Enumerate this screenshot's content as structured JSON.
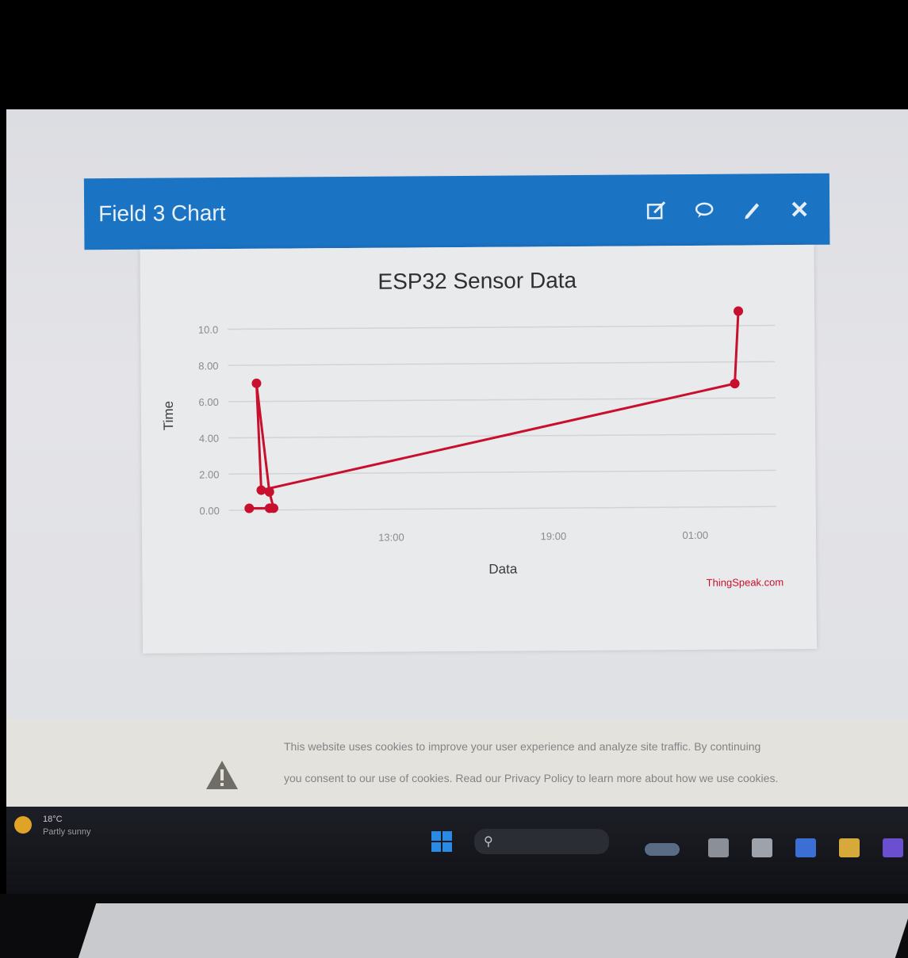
{
  "widget": {
    "title": "Field 3 Chart",
    "icons": [
      "edit-icon",
      "comment-icon",
      "pencil-icon",
      "close-icon"
    ]
  },
  "chart_data": {
    "type": "line",
    "title": "ESP32 Sensor Data",
    "xlabel": "Data",
    "ylabel": "Time",
    "y_ticks": [
      "10.0",
      "8.00",
      "6.00",
      "4.00",
      "2.00",
      "0.00"
    ],
    "x_ticks": [
      "13:00",
      "19:00",
      "01:00"
    ],
    "ylim": [
      0,
      10.5
    ],
    "series": [
      {
        "color": "#c8102e",
        "points": [
          {
            "x": 0.0,
            "y": 0.1
          },
          {
            "x": 0.5,
            "y": 0.1
          },
          {
            "x": 0.6,
            "y": 0.1
          },
          {
            "x": 0.5,
            "y": 1.0
          },
          {
            "x": 0.2,
            "y": 7.0
          },
          {
            "x": 0.3,
            "y": 1.1
          },
          {
            "x": 12.0,
            "y": 6.8
          },
          {
            "x": 12.1,
            "y": 10.8
          }
        ]
      }
    ],
    "xlim": [
      -0.5,
      13.0
    ],
    "credit": "ThingSpeak.com"
  },
  "notice": {
    "line1": "This website uses cookies to improve your user experience and analyze site traffic. By continuing",
    "line2": "you consent to our use of cookies. Read our Privacy Policy to learn more about how we use cookies."
  },
  "taskbar": {
    "weather_temp": "18°C",
    "weather_cond": "Partly sunny",
    "search_placeholder": "Search"
  }
}
